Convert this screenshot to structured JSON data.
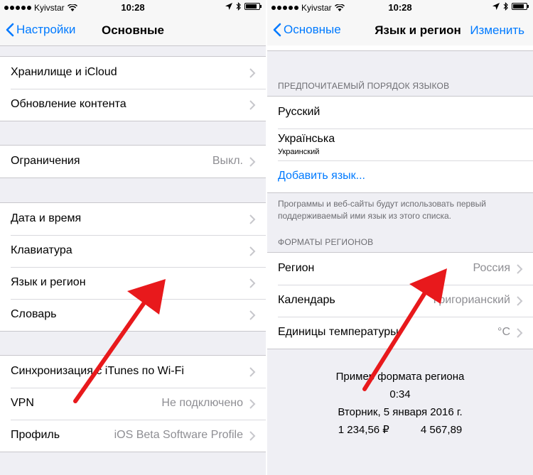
{
  "status": {
    "carrier": "Kyivstar",
    "time": "10:28"
  },
  "left": {
    "nav": {
      "back": "Настройки",
      "title": "Основные"
    },
    "group1": [
      {
        "label": "Хранилище и iCloud"
      },
      {
        "label": "Обновление контента"
      }
    ],
    "group2": [
      {
        "label": "Ограничения",
        "value": "Выкл."
      }
    ],
    "group3": [
      {
        "label": "Дата и время"
      },
      {
        "label": "Клавиатура"
      },
      {
        "label": "Язык и регион"
      },
      {
        "label": "Словарь"
      }
    ],
    "group4": [
      {
        "label": "Синхронизация с iTunes по Wi-Fi"
      },
      {
        "label": "VPN",
        "value": "Не подключено"
      },
      {
        "label": "Профиль",
        "value": "iOS Beta Software Profile"
      }
    ]
  },
  "right": {
    "nav": {
      "back": "Основные",
      "title": "Язык и регион",
      "action": "Изменить"
    },
    "lang_header": "ПРЕДПОЧИТАЕМЫЙ ПОРЯДОК ЯЗЫКОВ",
    "languages": [
      {
        "label": "Русский"
      },
      {
        "label": "Українська",
        "sub": "Украинский"
      }
    ],
    "add_language": "Добавить язык...",
    "lang_footer": "Программы и веб-сайты будут использовать первый поддерживаемый ими язык из этого списка.",
    "region_header": "ФОРМАТЫ РЕГИОНОВ",
    "region_cells": [
      {
        "label": "Регион",
        "value": "Россия"
      },
      {
        "label": "Календарь",
        "value": "Григорианский"
      },
      {
        "label": "Единицы температуры",
        "value": "°C"
      }
    ],
    "example": {
      "title": "Пример формата региона",
      "time": "0:34",
      "date": "Вторник, 5 января 2016 г.",
      "num1": "1 234,56 ₽",
      "num2": "4 567,89"
    }
  },
  "colors": {
    "accent": "#007aff",
    "arrow": "#e8191c",
    "background": "#efeff4"
  }
}
